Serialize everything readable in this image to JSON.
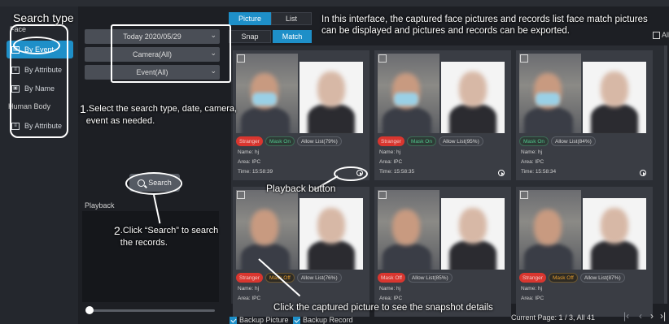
{
  "left_panel": {
    "face_label": "Face",
    "human_body_label": "Human Body",
    "items": [
      {
        "label": "By Event",
        "icon": "event-icon",
        "active": true
      },
      {
        "label": "By Attribute",
        "icon": "list-icon",
        "active": false
      },
      {
        "label": "By Name",
        "icon": "id-card-icon",
        "active": false
      },
      {
        "label": "By Attribute",
        "icon": "list-icon",
        "active": false
      }
    ]
  },
  "filters": {
    "date": "Today 2020/05/29",
    "camera": "Camera(All)",
    "event": "Event(All)"
  },
  "search_label": "Search",
  "playback_label": "Playback",
  "view_tabs": [
    "Picture",
    "List"
  ],
  "mode_tabs": [
    "Snap",
    "Match"
  ],
  "all_label": "All",
  "cards": [
    {
      "tags": [
        {
          "text": "Stranger",
          "style": "red"
        },
        {
          "text": "Mask On",
          "style": "green"
        },
        {
          "text": "Allow List(79%)",
          "style": "allow"
        }
      ],
      "name": "Name:  hj",
      "area": "Area:  IPC",
      "time": "Time:  15:58:39",
      "mask": true
    },
    {
      "tags": [
        {
          "text": "Stranger",
          "style": "red"
        },
        {
          "text": "Mask On",
          "style": "green"
        },
        {
          "text": "Allow List(95%)",
          "style": "allow"
        }
      ],
      "name": "Name:  hj",
      "area": "Area:  IPC",
      "time": "Time:  15:58:35",
      "mask": true
    },
    {
      "tags": [
        {
          "text": "Mask On",
          "style": "green"
        },
        {
          "text": "Allow List(84%)",
          "style": "allow"
        }
      ],
      "name": "Name:  hj",
      "area": "Area:  IPC",
      "time": "Time:  15:58:34",
      "mask": true
    },
    {
      "tags": [
        {
          "text": "Stranger",
          "style": "red"
        },
        {
          "text": "Mask Off",
          "style": "orange"
        },
        {
          "text": "Allow List(76%)",
          "style": "allow"
        }
      ],
      "name": "Name:  hj",
      "area": "Area:  IPC",
      "time": "",
      "mask": false
    },
    {
      "tags": [
        {
          "text": "Mask Off",
          "style": "red"
        },
        {
          "text": "Allow List(85%)",
          "style": "allow"
        }
      ],
      "name": "Name:  hj",
      "area": "Area:  IPC",
      "time": "",
      "mask": false
    },
    {
      "tags": [
        {
          "text": "Stranger",
          "style": "red"
        },
        {
          "text": "Mask Off",
          "style": "orange"
        },
        {
          "text": "Allow List(87%)",
          "style": "allow"
        }
      ],
      "name": "Name:  hj",
      "area": "Area:  IPC",
      "time": "",
      "mask": false
    }
  ],
  "footer": {
    "backup_picture": "Backup Picture",
    "backup_record": "Backup Record",
    "page_info": "Current Page: 1 / 3, All 41"
  },
  "annotations": {
    "title": "Search type",
    "intro": "In this interface, the captured face pictures and records list face match pictures can be displayed and pictures and records can be exported.",
    "step1_num": "1",
    "step1_text": ".Select the search type, date, camera, event as needed.",
    "step2_num": "2",
    "step2_text": ".Click “Search” to search the records.",
    "playback_button": "Playback button",
    "click_picture": "Click the captured picture to see the snapshot details"
  },
  "colors": {
    "accent": "#1e8fc8",
    "background": "#1d1f24",
    "stranger": "#d9362f",
    "mask_on": "#4fc48c",
    "mask_off": "#e39b2c"
  }
}
